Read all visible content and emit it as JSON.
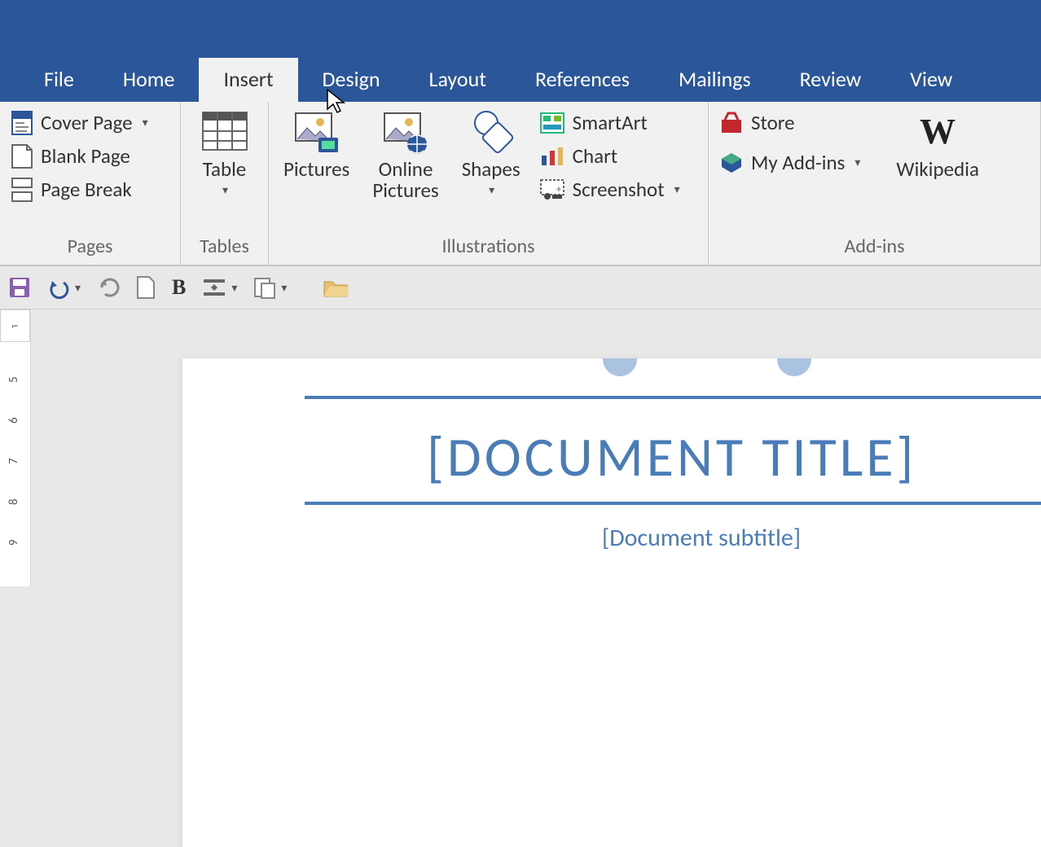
{
  "tabs": {
    "file": "File",
    "home": "Home",
    "insert": "Insert",
    "design": "Design",
    "layout": "Layout",
    "references": "References",
    "mailings": "Mailings",
    "review": "Review",
    "view": "View"
  },
  "pages_group": {
    "cover_page": "Cover Page",
    "blank_page": "Blank Page",
    "page_break": "Page Break",
    "label": "Pages"
  },
  "tables_group": {
    "table": "Table",
    "label": "Tables"
  },
  "illustrations_group": {
    "pictures": "Pictures",
    "online_pictures": "Online Pictures",
    "shapes": "Shapes",
    "smartart": "SmartArt",
    "chart": "Chart",
    "screenshot": "Screenshot",
    "label": "Illustrations"
  },
  "addins_group": {
    "store": "Store",
    "my_addins": "My Add-ins",
    "wikipedia": "Wikipedia",
    "label": "Add-ins"
  },
  "document": {
    "title_placeholder": "[DOCUMENT TITLE]",
    "subtitle_placeholder": "[Document subtitle]"
  },
  "ruler": {
    "marks": [
      "5",
      "6",
      "7",
      "8",
      "9"
    ]
  }
}
